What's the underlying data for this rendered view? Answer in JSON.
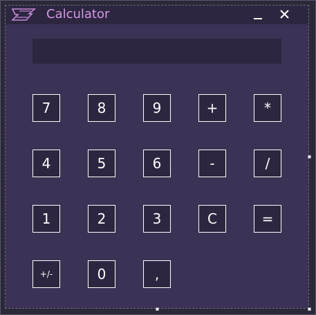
{
  "window": {
    "title": "Calculator",
    "logo_icon": "calculator-logo-icon",
    "minimize_icon": "minimize-icon",
    "close_icon": "close-icon",
    "title_color": "#d49ae4",
    "background_color": "#3c3255"
  },
  "display": {
    "value": ""
  },
  "keypad": {
    "rows": [
      [
        "7",
        "8",
        "9",
        "+",
        "*"
      ],
      [
        "4",
        "5",
        "6",
        "-",
        "/"
      ],
      [
        "1",
        "2",
        "3",
        "C",
        "="
      ],
      [
        "+/-",
        "0",
        ","
      ]
    ]
  }
}
